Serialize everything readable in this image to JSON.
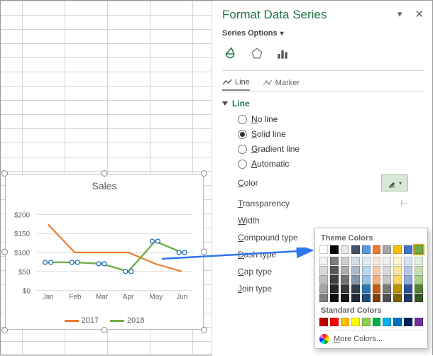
{
  "pane": {
    "title": "Format Data Series",
    "subtitle": "Series Options",
    "tabs": {
      "line": "Line",
      "marker": "Marker"
    },
    "section": "Line",
    "radios": {
      "no_line": "o line",
      "solid_line": "olid line",
      "gradient_line": "radient line",
      "automatic": "utomatic",
      "no_line_u": "N",
      "solid_line_u": "S",
      "gradient_line_u": "G",
      "automatic_u": "A"
    },
    "props": {
      "color": "olor",
      "color_u": "C",
      "transparency": "ransparency",
      "transparency_u": "T",
      "width": "idth",
      "width_u": "W",
      "compound": "ompound type",
      "compound_u": "C",
      "dash": "ash type",
      "dash_u": "D",
      "cap": "ap type",
      "cap_u": "C",
      "join": "oin type",
      "join_u": "J"
    }
  },
  "picker": {
    "theme_label": "Theme Colors",
    "standard_label": "Standard Colors",
    "more_colors_u": "M",
    "more_colors": "ore Colors...",
    "theme_row": [
      "#ffffff",
      "#000000",
      "#e7e6e6",
      "#44546a",
      "#5b9bd5",
      "#ed7d31",
      "#a5a5a5",
      "#ffc000",
      "#4472c4",
      "#70ad47"
    ],
    "shades": [
      [
        "#f2f2f2",
        "#7f7f7f",
        "#d0cece",
        "#d6dce4",
        "#deebf6",
        "#fbe5d5",
        "#ededed",
        "#fff2cc",
        "#d9e2f3",
        "#e2efd9"
      ],
      [
        "#d8d8d8",
        "#595959",
        "#aeabab",
        "#adb9ca",
        "#bdd7ee",
        "#f7cbac",
        "#dbdbdb",
        "#fee599",
        "#b4c6e7",
        "#c5e0b3"
      ],
      [
        "#bfbfbf",
        "#3f3f3f",
        "#757070",
        "#8496b0",
        "#9cc3e5",
        "#f4b183",
        "#c9c9c9",
        "#ffd965",
        "#8eaadb",
        "#a8d08d"
      ],
      [
        "#a5a5a5",
        "#262626",
        "#3a3838",
        "#323f4f",
        "#2e75b5",
        "#c55a11",
        "#7b7b7b",
        "#bf9000",
        "#2f5496",
        "#538135"
      ],
      [
        "#7f7f7f",
        "#0c0c0c",
        "#171616",
        "#222a35",
        "#1e4e79",
        "#833c0b",
        "#525252",
        "#7f6000",
        "#1f3864",
        "#375623"
      ]
    ],
    "standard_row": [
      "#c00000",
      "#ff0000",
      "#ffc000",
      "#ffff00",
      "#92d050",
      "#00b050",
      "#00b0f0",
      "#0070c0",
      "#002060",
      "#7030a0"
    ]
  },
  "chart": {
    "title": "Sales",
    "legend": [
      "2017",
      "2018"
    ],
    "colors": {
      "s2017": "#ed7d31",
      "s2018": "#70ad47",
      "marker_outline": "#2e75b5"
    }
  },
  "chart_data": {
    "type": "line",
    "categories": [
      "Jan",
      "Feb",
      "Mar",
      "Apr",
      "May",
      "Jun"
    ],
    "series": [
      {
        "name": "2017",
        "values": [
          160,
          100,
          100,
          100,
          70,
          50
        ]
      },
      {
        "name": "2018",
        "values": [
          75,
          75,
          70,
          50,
          130,
          100
        ]
      }
    ],
    "title": "Sales",
    "xlabel": "",
    "ylabel": "",
    "y_ticks": [
      "$200",
      "$150",
      "$100",
      "$50",
      "$0"
    ],
    "ylim": [
      0,
      200
    ]
  }
}
